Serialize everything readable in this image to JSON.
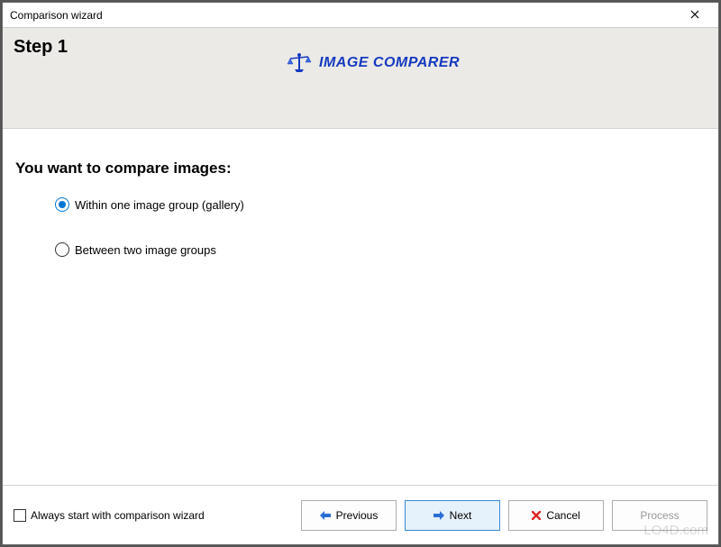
{
  "titlebar": {
    "title": "Comparison wizard"
  },
  "header": {
    "step_title": "Step 1",
    "logo_text": "IMAGE COMPARER"
  },
  "content": {
    "heading": "You want to compare images:",
    "radios": {
      "option1": {
        "label": "Within one image group (gallery)",
        "selected": true
      },
      "option2": {
        "label": "Between two image groups",
        "selected": false
      }
    }
  },
  "footer": {
    "checkbox_label": "Always start with comparison wizard",
    "checkbox_checked": false,
    "buttons": {
      "previous": "Previous",
      "next": "Next",
      "cancel": "Cancel",
      "process": "Process"
    }
  },
  "watermark": "LO4D.com"
}
